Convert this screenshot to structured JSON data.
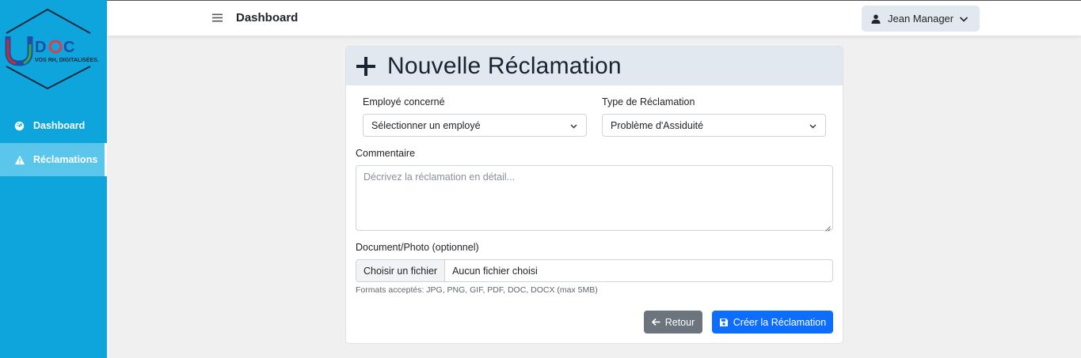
{
  "sidebar": {
    "logo": {
      "brand": "DOC",
      "tagline": "VOS RH, DIGITALISÉES."
    },
    "items": [
      {
        "label": "Dashboard",
        "icon": "gauge-icon",
        "active": false
      },
      {
        "label": "Réclamations",
        "icon": "warning-icon",
        "active": true
      }
    ]
  },
  "topbar": {
    "title": "Dashboard",
    "user": "Jean Manager"
  },
  "form": {
    "title": "Nouvelle Réclamation",
    "employee_label": "Employé concerné",
    "employee_value": "Sélectionner un employé",
    "type_label": "Type de Réclamation",
    "type_value": "Problème d'Assiduité",
    "comment_label": "Commentaire",
    "comment_placeholder": "Décrivez la réclamation en détail...",
    "document_label": "Document/Photo (optionnel)",
    "file_button": "Choisir un fichier",
    "file_status": "Aucun fichier choisi",
    "formats_hint": "Formats acceptés: JPG, PNG, GIF, PDF, DOC, DOCX (max 5MB)",
    "back_label": "Retour",
    "create_label": "Créer la Réclamation"
  },
  "colors": {
    "sidebar": "#0ea5dc",
    "sidebar_active": "#5bc6ec",
    "primary": "#0d6efd",
    "secondary": "#6c757d",
    "header_bg": "#e2e8f0"
  }
}
